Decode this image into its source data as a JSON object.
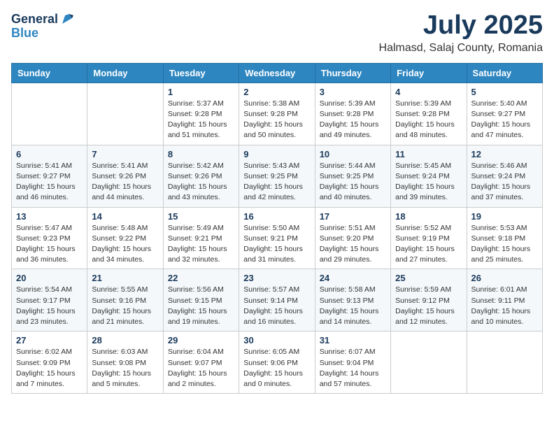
{
  "header": {
    "logo_general": "General",
    "logo_blue": "Blue",
    "month": "July 2025",
    "location": "Halmasd, Salaj County, Romania"
  },
  "weekdays": [
    "Sunday",
    "Monday",
    "Tuesday",
    "Wednesday",
    "Thursday",
    "Friday",
    "Saturday"
  ],
  "weeks": [
    [
      {
        "day": "",
        "info": ""
      },
      {
        "day": "",
        "info": ""
      },
      {
        "day": "1",
        "info": "Sunrise: 5:37 AM\nSunset: 9:28 PM\nDaylight: 15 hours\nand 51 minutes."
      },
      {
        "day": "2",
        "info": "Sunrise: 5:38 AM\nSunset: 9:28 PM\nDaylight: 15 hours\nand 50 minutes."
      },
      {
        "day": "3",
        "info": "Sunrise: 5:39 AM\nSunset: 9:28 PM\nDaylight: 15 hours\nand 49 minutes."
      },
      {
        "day": "4",
        "info": "Sunrise: 5:39 AM\nSunset: 9:28 PM\nDaylight: 15 hours\nand 48 minutes."
      },
      {
        "day": "5",
        "info": "Sunrise: 5:40 AM\nSunset: 9:27 PM\nDaylight: 15 hours\nand 47 minutes."
      }
    ],
    [
      {
        "day": "6",
        "info": "Sunrise: 5:41 AM\nSunset: 9:27 PM\nDaylight: 15 hours\nand 46 minutes."
      },
      {
        "day": "7",
        "info": "Sunrise: 5:41 AM\nSunset: 9:26 PM\nDaylight: 15 hours\nand 44 minutes."
      },
      {
        "day": "8",
        "info": "Sunrise: 5:42 AM\nSunset: 9:26 PM\nDaylight: 15 hours\nand 43 minutes."
      },
      {
        "day": "9",
        "info": "Sunrise: 5:43 AM\nSunset: 9:25 PM\nDaylight: 15 hours\nand 42 minutes."
      },
      {
        "day": "10",
        "info": "Sunrise: 5:44 AM\nSunset: 9:25 PM\nDaylight: 15 hours\nand 40 minutes."
      },
      {
        "day": "11",
        "info": "Sunrise: 5:45 AM\nSunset: 9:24 PM\nDaylight: 15 hours\nand 39 minutes."
      },
      {
        "day": "12",
        "info": "Sunrise: 5:46 AM\nSunset: 9:24 PM\nDaylight: 15 hours\nand 37 minutes."
      }
    ],
    [
      {
        "day": "13",
        "info": "Sunrise: 5:47 AM\nSunset: 9:23 PM\nDaylight: 15 hours\nand 36 minutes."
      },
      {
        "day": "14",
        "info": "Sunrise: 5:48 AM\nSunset: 9:22 PM\nDaylight: 15 hours\nand 34 minutes."
      },
      {
        "day": "15",
        "info": "Sunrise: 5:49 AM\nSunset: 9:21 PM\nDaylight: 15 hours\nand 32 minutes."
      },
      {
        "day": "16",
        "info": "Sunrise: 5:50 AM\nSunset: 9:21 PM\nDaylight: 15 hours\nand 31 minutes."
      },
      {
        "day": "17",
        "info": "Sunrise: 5:51 AM\nSunset: 9:20 PM\nDaylight: 15 hours\nand 29 minutes."
      },
      {
        "day": "18",
        "info": "Sunrise: 5:52 AM\nSunset: 9:19 PM\nDaylight: 15 hours\nand 27 minutes."
      },
      {
        "day": "19",
        "info": "Sunrise: 5:53 AM\nSunset: 9:18 PM\nDaylight: 15 hours\nand 25 minutes."
      }
    ],
    [
      {
        "day": "20",
        "info": "Sunrise: 5:54 AM\nSunset: 9:17 PM\nDaylight: 15 hours\nand 23 minutes."
      },
      {
        "day": "21",
        "info": "Sunrise: 5:55 AM\nSunset: 9:16 PM\nDaylight: 15 hours\nand 21 minutes."
      },
      {
        "day": "22",
        "info": "Sunrise: 5:56 AM\nSunset: 9:15 PM\nDaylight: 15 hours\nand 19 minutes."
      },
      {
        "day": "23",
        "info": "Sunrise: 5:57 AM\nSunset: 9:14 PM\nDaylight: 15 hours\nand 16 minutes."
      },
      {
        "day": "24",
        "info": "Sunrise: 5:58 AM\nSunset: 9:13 PM\nDaylight: 15 hours\nand 14 minutes."
      },
      {
        "day": "25",
        "info": "Sunrise: 5:59 AM\nSunset: 9:12 PM\nDaylight: 15 hours\nand 12 minutes."
      },
      {
        "day": "26",
        "info": "Sunrise: 6:01 AM\nSunset: 9:11 PM\nDaylight: 15 hours\nand 10 minutes."
      }
    ],
    [
      {
        "day": "27",
        "info": "Sunrise: 6:02 AM\nSunset: 9:09 PM\nDaylight: 15 hours\nand 7 minutes."
      },
      {
        "day": "28",
        "info": "Sunrise: 6:03 AM\nSunset: 9:08 PM\nDaylight: 15 hours\nand 5 minutes."
      },
      {
        "day": "29",
        "info": "Sunrise: 6:04 AM\nSunset: 9:07 PM\nDaylight: 15 hours\nand 2 minutes."
      },
      {
        "day": "30",
        "info": "Sunrise: 6:05 AM\nSunset: 9:06 PM\nDaylight: 15 hours\nand 0 minutes."
      },
      {
        "day": "31",
        "info": "Sunrise: 6:07 AM\nSunset: 9:04 PM\nDaylight: 14 hours\nand 57 minutes."
      },
      {
        "day": "",
        "info": ""
      },
      {
        "day": "",
        "info": ""
      }
    ]
  ]
}
